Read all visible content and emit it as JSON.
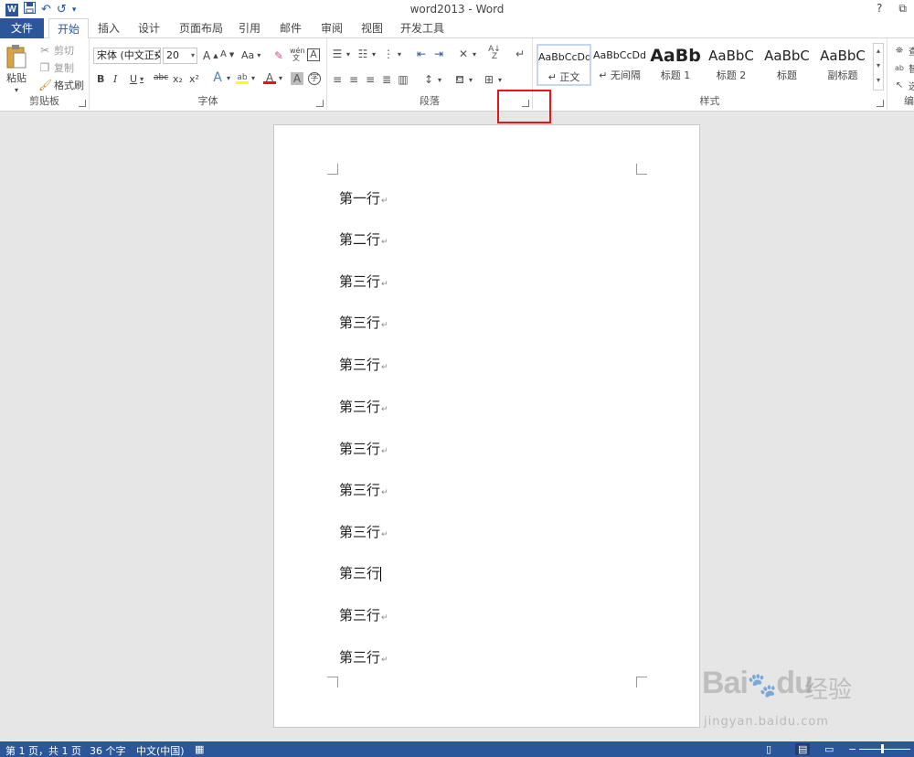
{
  "window": {
    "title": "word2013 - Word",
    "help": "?",
    "restore": "⧉"
  },
  "qat": {
    "logo": "W",
    "save": "save-icon",
    "undo": "↶",
    "redo": "↺"
  },
  "tabs": [
    "文件",
    "开始",
    "插入",
    "设计",
    "页面布局",
    "引用",
    "邮件",
    "审阅",
    "视图",
    "开发工具"
  ],
  "clipboard": {
    "paste": "粘贴",
    "cut": "剪切",
    "copy": "复制",
    "format_painter": "格式刷",
    "label": "剪贴板"
  },
  "font": {
    "name": "宋体 (中文正文",
    "size": "20",
    "label": "字体",
    "bold": "B",
    "italic": "I",
    "underline": "U",
    "strike": "abc",
    "sub": "x₂",
    "sup": "x²",
    "grow": "A",
    "shrink": "A",
    "case": "Aa",
    "phonetic": "wén 文"
  },
  "paragraph": {
    "label": "段落"
  },
  "styles": {
    "label": "样式",
    "items": [
      {
        "sample": "AaBbCcDd",
        "name": "↵ 正文"
      },
      {
        "sample": "AaBbCcDd",
        "name": "↵ 无间隔"
      },
      {
        "sample": "AaBb",
        "name": "标题 1"
      },
      {
        "sample": "AaBbC",
        "name": "标题 2"
      },
      {
        "sample": "AaBbC",
        "name": "标题"
      },
      {
        "sample": "AaBbC",
        "name": "副标题"
      }
    ]
  },
  "editing": {
    "find": "查",
    "replace": "替",
    "select": "选",
    "label": "编"
  },
  "document": {
    "lines": [
      "第一行",
      "第二行",
      "第三行",
      "第三行",
      "第三行",
      "第三行",
      "第三行",
      "第三行",
      "第三行",
      "第三行",
      "第三行",
      "第三行"
    ],
    "para_mark": "↵"
  },
  "statusbar": {
    "page": "第 1 页，共 1 页",
    "words": "36 个字",
    "language": "中文(中国)"
  },
  "watermark": {
    "brand": "Bai",
    "brand2": "du",
    "cn": "经验",
    "url": "jingyan.baidu.com"
  }
}
